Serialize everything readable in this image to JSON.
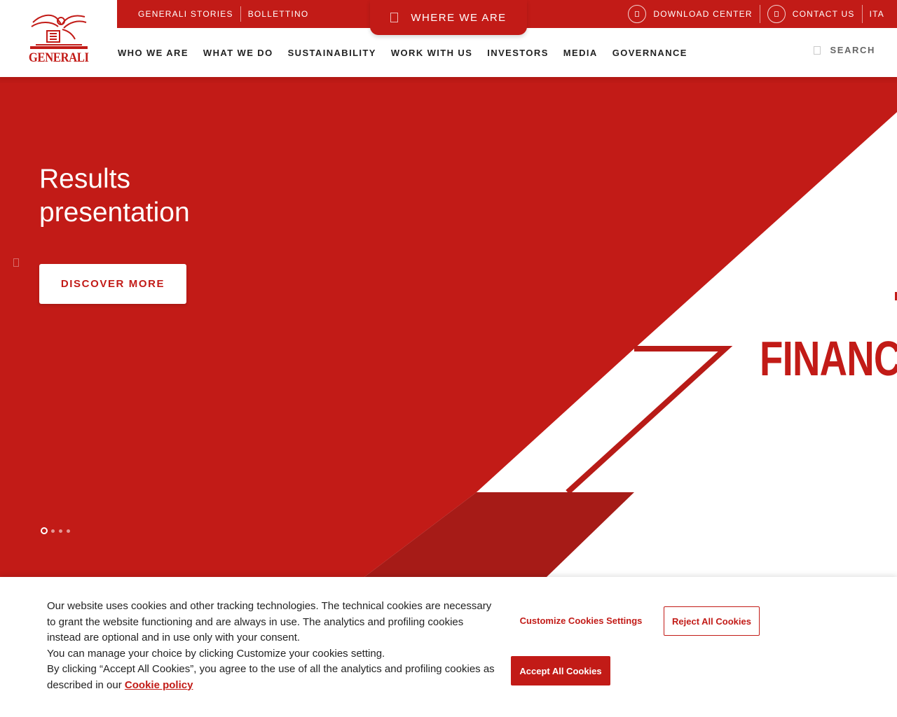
{
  "brand": {
    "logo_text": "GENERALI",
    "primary_color": "#c21b17",
    "dark_red": "#a61b17"
  },
  "topbar": {
    "links": [
      "GENERALI STORIES",
      "BOLLETTINO"
    ],
    "where_we_are": "WHERE WE ARE",
    "download_center": "DOWNLOAD CENTER",
    "contact_us": "CONTACT US",
    "language": "ITA"
  },
  "nav": {
    "items": [
      "WHO WE ARE",
      "WHAT WE DO",
      "SUSTAINABILITY",
      "WORK WITH US",
      "INVESTORS",
      "MEDIA",
      "GOVERNANCE"
    ],
    "search_label": "SEARCH"
  },
  "hero": {
    "title_line1": "Results",
    "title_line2": "presentation",
    "cta": "DISCOVER MORE",
    "background_word": "FINANC",
    "slides_total": 4,
    "slide_active": 1
  },
  "cookie_banner": {
    "text_line1": "Our website uses cookies and other tracking technologies. The technical cookies are necessary to grant the website functioning and are always in use. The analytics and profiling cookies instead are optional and in use only with your consent.",
    "text_line2": "You can manage your choice by clicking Customize your cookies setting.",
    "text_line3": "By clicking “Accept All Cookies”, you agree to the use of all the analytics and profiling cookies as described in our",
    "policy_link": "Cookie policy",
    "customize": "Customize Cookies Settings",
    "reject": "Reject All Cookies",
    "accept": "Accept All Cookies"
  }
}
